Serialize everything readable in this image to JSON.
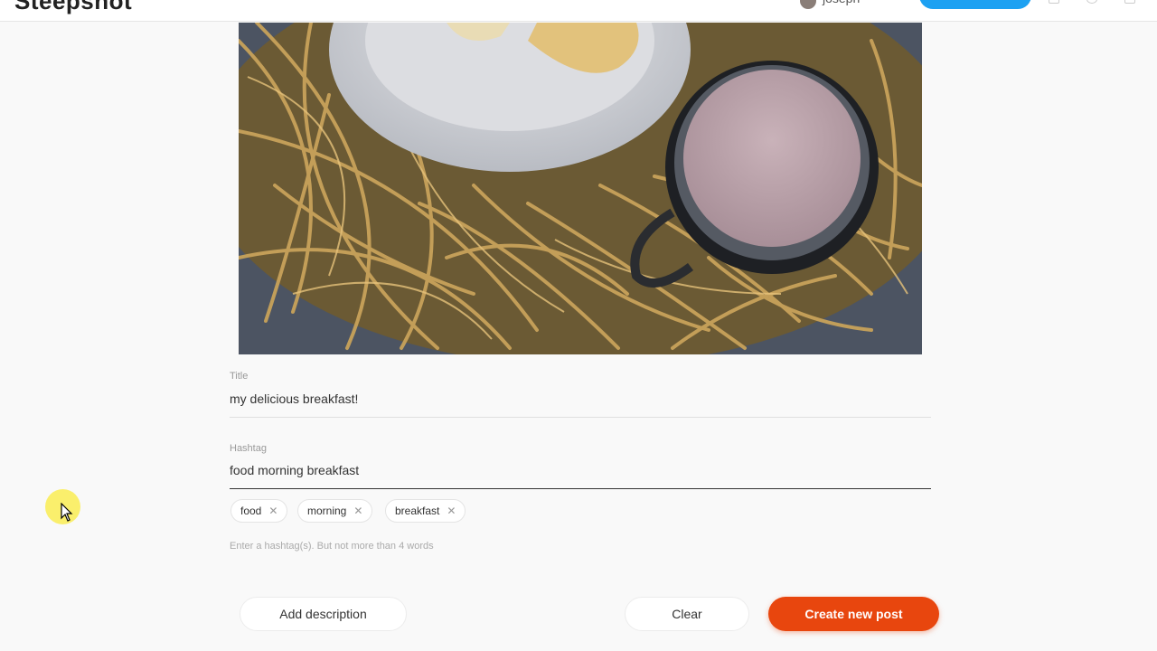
{
  "app": {
    "logo_text": "Steepshot"
  },
  "header": {
    "username": "joseph",
    "avatar_color": "#8a7e78",
    "accent_button_color": "#1da1f2"
  },
  "form": {
    "title": {
      "label": "Title",
      "value": "my delicious breakfast!"
    },
    "hashtag": {
      "label": "Hashtag",
      "value": "food morning breakfast",
      "tags": [
        "food",
        "morning",
        "breakfast"
      ],
      "hint": "Enter a hashtag(s). But not more than 4 words"
    }
  },
  "actions": {
    "add_description": "Add description",
    "clear": "Clear",
    "create": "Create new post",
    "create_color": "#e8460e"
  }
}
